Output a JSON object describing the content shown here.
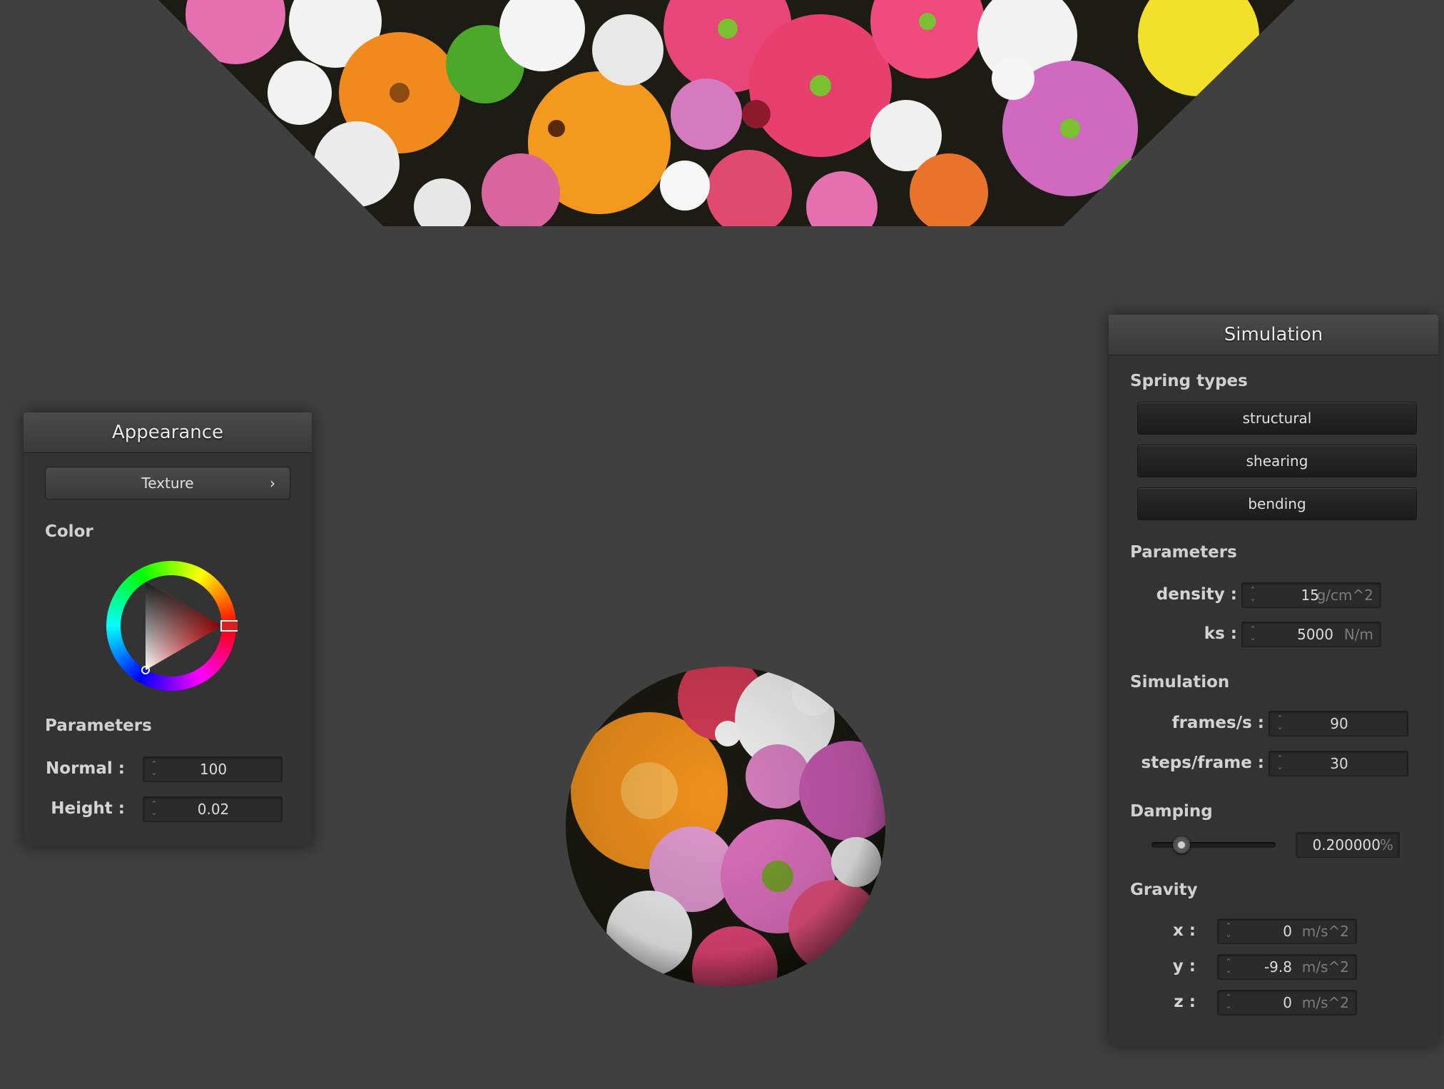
{
  "appearance": {
    "title": "Appearance",
    "texture_button": "Texture",
    "color_label": "Color",
    "selected_color": "#ff0000",
    "parameters_label": "Parameters",
    "normal": {
      "label": "Normal :",
      "value": "100"
    },
    "height": {
      "label": "Height :",
      "value": "0.02"
    }
  },
  "simulation": {
    "title": "Simulation",
    "spring_types_label": "Spring types",
    "springs": [
      "structural",
      "shearing",
      "bending"
    ],
    "parameters_label": "Parameters",
    "density": {
      "label": "density :",
      "value": "15",
      "unit": "g/cm^2"
    },
    "ks": {
      "label": "ks :",
      "value": "5000",
      "unit": "N/m"
    },
    "simulation_label": "Simulation",
    "frames": {
      "label": "frames/s :",
      "value": "90"
    },
    "steps": {
      "label": "steps/frame :",
      "value": "30"
    },
    "damping_label": "Damping",
    "damping": {
      "value": "0.200000",
      "unit": "%",
      "slider_fraction": 0.2
    },
    "gravity_label": "Gravity",
    "gravity": [
      {
        "label": "x :",
        "value": "0",
        "unit": "m/s^2"
      },
      {
        "label": "y :",
        "value": "-9.8",
        "unit": "m/s^2"
      },
      {
        "label": "z :",
        "value": "0",
        "unit": "m/s^2"
      }
    ]
  }
}
